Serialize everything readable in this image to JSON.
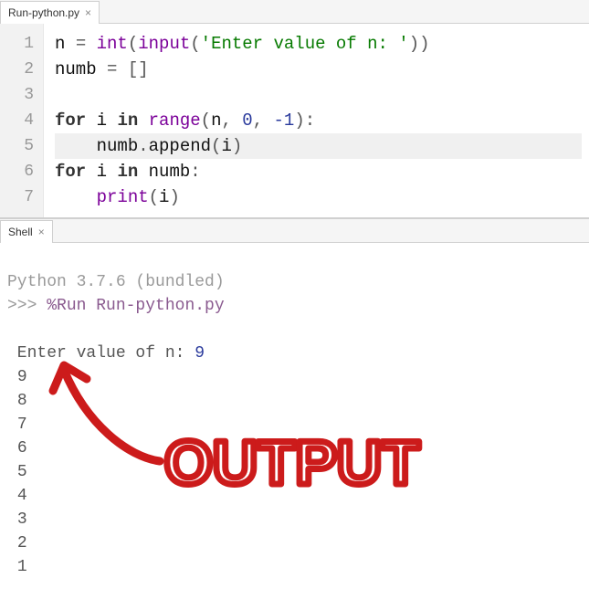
{
  "editor_tab": {
    "filename": "Run-python.py"
  },
  "code": {
    "line_numbers": [
      "1",
      "2",
      "3",
      "4",
      "5",
      "6",
      "7"
    ],
    "l1": {
      "v_n": "n",
      "op": "=",
      "fn_int": "int",
      "lp": "(",
      "fn_input": "input",
      "lp2": "(",
      "str": "'Enter value of n: '",
      "rp2": ")",
      "rp": ")"
    },
    "l2": {
      "v_numb": "numb",
      "op": "=",
      "br": "[]"
    },
    "l4": {
      "kw_for": "for",
      "v_i": "i",
      "kw_in": "in",
      "fn_range": "range",
      "lp": "(",
      "a1": "n",
      "c1": ",",
      "a2": "0",
      "c2": ",",
      "a3": "-1",
      "rp": ")",
      "colon": ":"
    },
    "l5": {
      "indent": "    ",
      "v_numb": "numb",
      "dot": ".",
      "fn_append": "append",
      "lp": "(",
      "arg": "i",
      "rp": ")"
    },
    "l6": {
      "kw_for": "for",
      "v_i": "i",
      "kw_in": "in",
      "v_numb": "numb",
      "colon": ":"
    },
    "l7": {
      "indent": "    ",
      "fn_print": "print",
      "lp": "(",
      "arg": "i",
      "rp": ")"
    }
  },
  "shell_tab": {
    "label": "Shell"
  },
  "shell": {
    "version_line": "Python 3.7.6 (bundled)",
    "prompt": ">>>",
    "run_cmd": "%Run Run-python.py",
    "input_prompt": " Enter value of n: ",
    "input_value": "9",
    "output_lines": [
      "9",
      "8",
      "7",
      "6",
      "5",
      "4",
      "3",
      "2",
      "1"
    ]
  },
  "annotation": {
    "text": "OUTPUT",
    "color": "#cc1b1b"
  }
}
